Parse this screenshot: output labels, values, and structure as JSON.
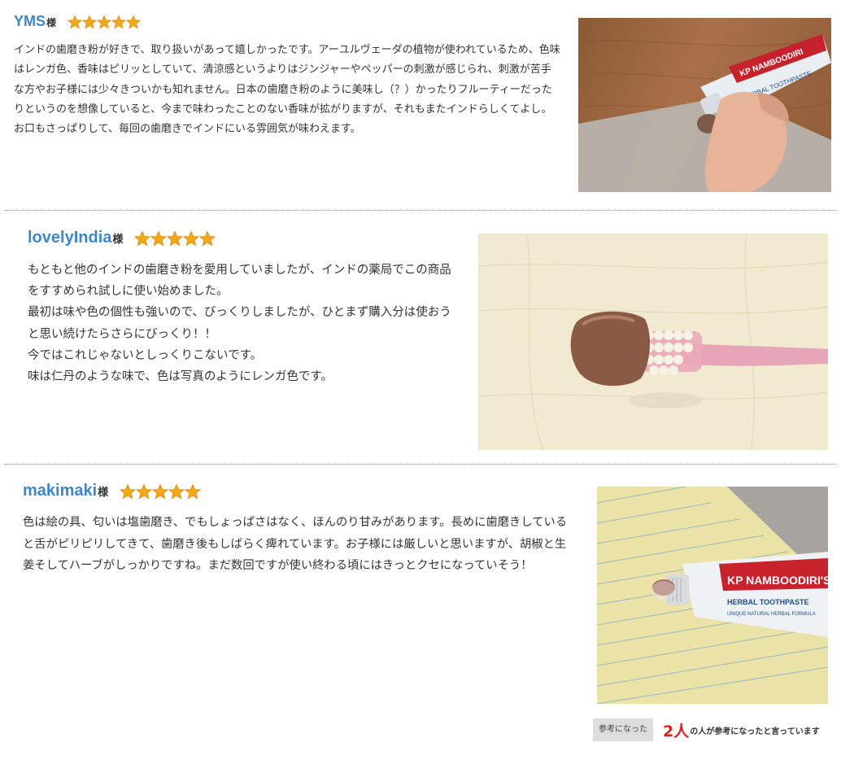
{
  "rating_color": "#f3a81c",
  "name_color": "#3f86c6",
  "reviews": [
    {
      "name": "YMS",
      "honorific": "様",
      "rating": 5,
      "max_rating": 5,
      "text": "インドの歯磨き粉が好きで、取り扱いがあって嬉しかったです。アーユルヴェーダの植物が使われているため、色味はレンガ色、香味はピリッとしていて、清涼感というよりはジンジャーやペッパーの刺激が感じられ、刺激が苦手な方やお子様には少々きついかも知れません。日本の歯磨き粉のように美味し（？）かったりフルーティーだったりというのを想像していると、今まで味わったことのない香味が拡がりますが、それもまたインドらしくてよし。お口もさっぱりして、毎回の歯磨きでインドにいる雰囲気が味わえます。",
      "photo_icon": "toothpaste-tube-photo",
      "photo_text": {
        "brand": "KP NAMBOODIRI",
        "sub": "HERBAL TOOTHPASTE"
      }
    },
    {
      "name": "lovelyIndia",
      "honorific": "様",
      "rating": 5,
      "max_rating": 5,
      "text": "もともと他のインドの歯磨き粉を愛用していましたが、インドの薬局でこの商品をすすめられ試しに使い始めました。\n最初は味や色の個性も強いので、びっくりしましたが、ひとまず購入分は使おうと思い続けたらさらにびっくり！！\n今ではこれじゃないとしっくりこないです。\n味は仁丹のような味で、色は写真のようにレンガ色です。",
      "photo_icon": "toothbrush-photo"
    },
    {
      "name": "makimaki",
      "honorific": "様",
      "rating": 5,
      "max_rating": 5,
      "text": "色は絵の具、匂いは塩歯磨き、でもしょっぱさはなく、ほんのり甘みがあります。長めに歯磨きしていると舌がピリピリしてきて、歯磨き後もしばらく痺れています。お子様には厳しいと思いますが、胡椒と生姜そしてハーブがしっかりですね。まだ数回ですが使い終わる頃にはきっとクセになっていそう！",
      "photo_icon": "toothpaste-on-notepad-photo",
      "photo_text": {
        "brand": "KP NAMBOODIRI'S",
        "sub": "HERBAL TOOTHPASTE",
        "tag": "UNIQUE NATURAL HERBAL FORMULA"
      }
    }
  ],
  "helpful": {
    "button_label": "参考になった",
    "count": "2人",
    "suffix": "の人が参考になったと言っています"
  }
}
